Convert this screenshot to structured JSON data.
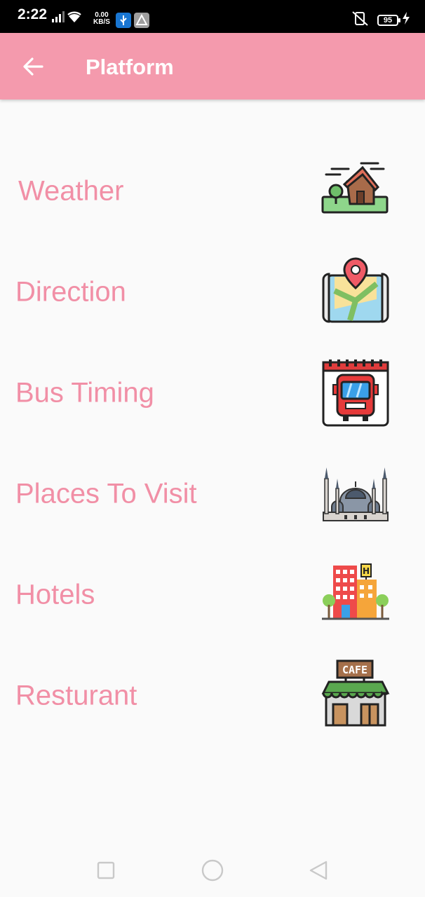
{
  "status_bar": {
    "time": "2:22",
    "speed_value": "0.00",
    "speed_unit": "KB/S",
    "battery": "95"
  },
  "app_bar": {
    "title": "Platform",
    "background": "#f49aad"
  },
  "menu": {
    "label_color": "#f18fa6",
    "items": [
      {
        "label": "Weather",
        "icon": "weather-house-icon"
      },
      {
        "label": "Direction",
        "icon": "map-pin-icon"
      },
      {
        "label": "Bus Timing",
        "icon": "bus-calendar-icon"
      },
      {
        "label": "Places To Visit",
        "icon": "mosque-icon"
      },
      {
        "label": "Hotels",
        "icon": "hotel-building-icon"
      },
      {
        "label": "Resturant",
        "icon": "cafe-store-icon"
      }
    ]
  },
  "icons": [
    "arrow-left-icon",
    "square-icon",
    "circle-icon",
    "triangle-back-icon"
  ]
}
